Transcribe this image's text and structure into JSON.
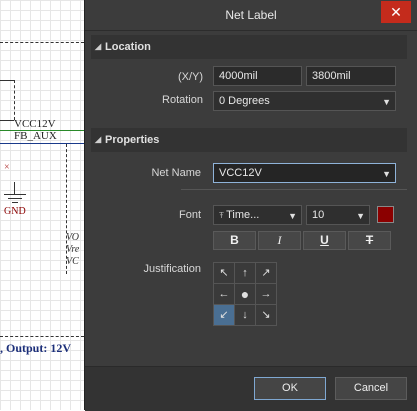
{
  "schematic": {
    "net_vcc": "VCC12V",
    "net_fb": "FB_AUX",
    "gnd": "GND",
    "side_lines": [
      "VO",
      "Vre",
      "VC"
    ],
    "bottom_text": ", Output: 12V"
  },
  "dialog": {
    "title": "Net Label",
    "close_glyph": "✕",
    "location": {
      "header": "Location",
      "xy_label": "(X/Y)",
      "x_value": "4000mil",
      "y_value": "3800mil",
      "rotation_label": "Rotation",
      "rotation_value": "0 Degrees"
    },
    "properties": {
      "header": "Properties",
      "net_name_label": "Net Name",
      "net_name_value": "VCC12V",
      "font_label": "Font",
      "font_family_value": "Time...",
      "font_size_value": "10",
      "font_color": "#8b0000",
      "bold_glyph": "B",
      "italic_glyph": "I",
      "underline_glyph": "U",
      "strike_glyph": "T",
      "justification_label": "Justification",
      "justification_cells": [
        "↖",
        "↑",
        "↗",
        "←",
        "●",
        "→",
        "↙",
        "↓",
        "↘"
      ],
      "justification_selected": "bottom-left"
    },
    "buttons": {
      "ok": "OK",
      "cancel": "Cancel"
    }
  }
}
